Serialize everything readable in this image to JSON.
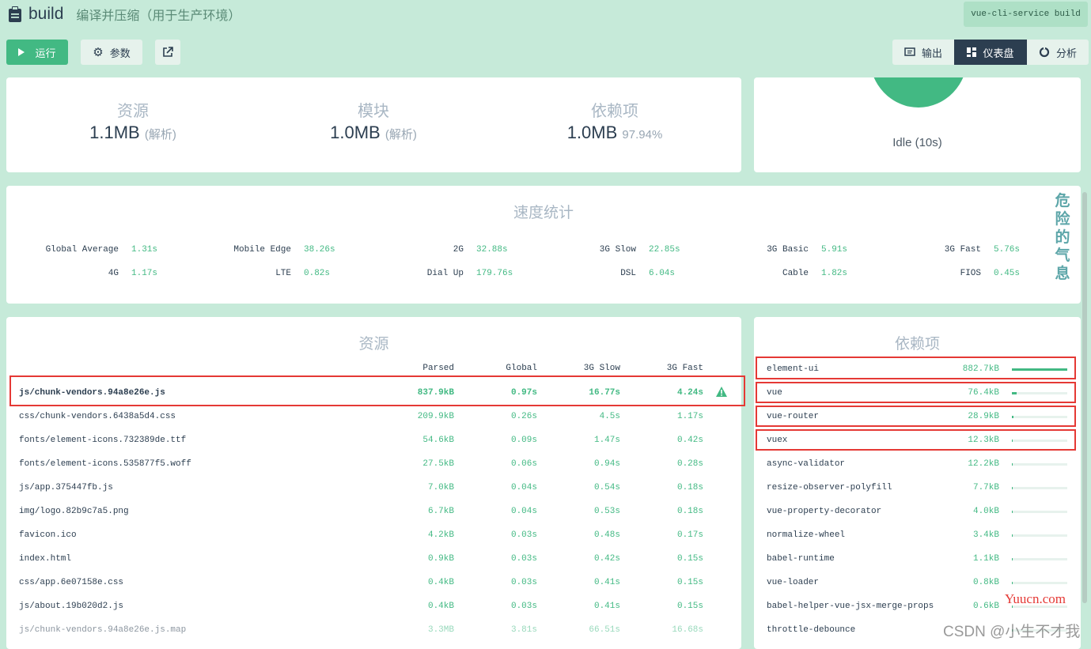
{
  "header": {
    "task_name": "build",
    "task_desc": "编译并压缩（用于生产环境）",
    "command": "vue-cli-service build",
    "run_label": "运行",
    "params_label": "参数",
    "views": {
      "output": "输出",
      "dashboard": "仪表盘",
      "analyze": "分析"
    }
  },
  "stats": [
    {
      "label": "资源",
      "value": "1.1MB",
      "note": "(解析)"
    },
    {
      "label": "模块",
      "value": "1.0MB",
      "note": "(解析)"
    },
    {
      "label": "依赖项",
      "value": "1.0MB",
      "note": "97.94%"
    }
  ],
  "status": {
    "text": "Idle (10s)"
  },
  "speed": {
    "title": "速度统计",
    "side_text": "危险的气息",
    "rows": [
      [
        {
          "k": "Global Average",
          "v": "1.31s"
        },
        {
          "k": "Mobile Edge",
          "v": "38.26s"
        },
        {
          "k": "2G",
          "v": "32.88s"
        },
        {
          "k": "3G Slow",
          "v": "22.85s"
        },
        {
          "k": "3G Basic",
          "v": "5.91s"
        },
        {
          "k": "3G Fast",
          "v": "5.76s"
        }
      ],
      [
        {
          "k": "4G",
          "v": "1.17s"
        },
        {
          "k": "LTE",
          "v": "0.82s"
        },
        {
          "k": "Dial Up",
          "v": "179.76s"
        },
        {
          "k": "DSL",
          "v": "6.04s"
        },
        {
          "k": "Cable",
          "v": "1.82s"
        },
        {
          "k": "FIOS",
          "v": "0.45s"
        }
      ]
    ]
  },
  "assets": {
    "title": "资源",
    "headers": [
      "Parsed",
      "Global",
      "3G Slow",
      "3G Fast"
    ],
    "rows": [
      {
        "name": "js/chunk-vendors.94a8e26e.js",
        "parsed": "837.9kB",
        "global": "0.97s",
        "slow": "16.77s",
        "fast": "4.24s",
        "warn": true
      },
      {
        "name": "css/chunk-vendors.6438a5d4.css",
        "parsed": "209.9kB",
        "global": "0.26s",
        "slow": "4.5s",
        "fast": "1.17s"
      },
      {
        "name": "fonts/element-icons.732389de.ttf",
        "parsed": "54.6kB",
        "global": "0.09s",
        "slow": "1.47s",
        "fast": "0.42s"
      },
      {
        "name": "fonts/element-icons.535877f5.woff",
        "parsed": "27.5kB",
        "global": "0.06s",
        "slow": "0.94s",
        "fast": "0.28s"
      },
      {
        "name": "js/app.375447fb.js",
        "parsed": "7.0kB",
        "global": "0.04s",
        "slow": "0.54s",
        "fast": "0.18s"
      },
      {
        "name": "img/logo.82b9c7a5.png",
        "parsed": "6.7kB",
        "global": "0.04s",
        "slow": "0.53s",
        "fast": "0.18s"
      },
      {
        "name": "favicon.ico",
        "parsed": "4.2kB",
        "global": "0.03s",
        "slow": "0.48s",
        "fast": "0.17s"
      },
      {
        "name": "index.html",
        "parsed": "0.9kB",
        "global": "0.03s",
        "slow": "0.42s",
        "fast": "0.15s"
      },
      {
        "name": "css/app.6e07158e.css",
        "parsed": "0.4kB",
        "global": "0.03s",
        "slow": "0.41s",
        "fast": "0.15s"
      },
      {
        "name": "js/about.19b020d2.js",
        "parsed": "0.4kB",
        "global": "0.03s",
        "slow": "0.41s",
        "fast": "0.15s"
      },
      {
        "name": "js/chunk-vendors.94a8e26e.js.map",
        "parsed": "3.3MB",
        "global": "3.81s",
        "slow": "66.51s",
        "fast": "16.68s",
        "faded": true
      }
    ]
  },
  "deps": {
    "title": "依赖项",
    "rows": [
      {
        "name": "element-ui",
        "size": "882.7kB",
        "ratio": 1.0
      },
      {
        "name": "vue",
        "size": "76.4kB",
        "ratio": 0.087
      },
      {
        "name": "vue-router",
        "size": "28.9kB",
        "ratio": 0.033
      },
      {
        "name": "vuex",
        "size": "12.3kB",
        "ratio": 0.014
      },
      {
        "name": "async-validator",
        "size": "12.2kB",
        "ratio": 0.014
      },
      {
        "name": "resize-observer-polyfill",
        "size": "7.7kB",
        "ratio": 0.009
      },
      {
        "name": "vue-property-decorator",
        "size": "4.0kB",
        "ratio": 0.005
      },
      {
        "name": "normalize-wheel",
        "size": "3.4kB",
        "ratio": 0.004
      },
      {
        "name": "babel-runtime",
        "size": "1.1kB",
        "ratio": 0.001
      },
      {
        "name": "vue-loader",
        "size": "0.8kB",
        "ratio": 0.001
      },
      {
        "name": "babel-helper-vue-jsx-merge-props",
        "size": "0.6kB",
        "ratio": 0.001
      },
      {
        "name": "throttle-debounce",
        "size": "",
        "ratio": 0.001
      }
    ]
  },
  "watermarks": {
    "site": "Yuucn.com",
    "csdn": "CSDN @小生不才我"
  },
  "colors": {
    "accent": "#42b983",
    "dark": "#2c3e50",
    "highlight": "#e53935"
  }
}
